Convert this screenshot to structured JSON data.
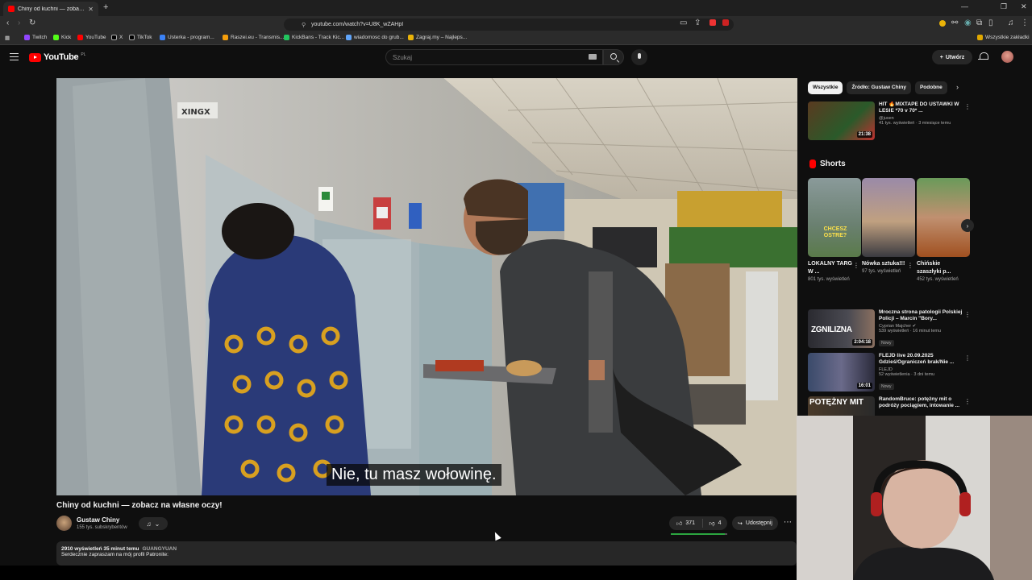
{
  "browser": {
    "tab_title": "Chiny od kuchni — zobacz na",
    "url": "youtube.com/watch?v=U8K_wZAHpI",
    "bookmarks": [
      "Twitch",
      "Kick",
      "YouTube",
      "X",
      "TikTok",
      "Usterka - program...",
      "Raszei.eu - Transmis...",
      "KickBans - Track Kic...",
      "wiadomosc do grub...",
      "Zagraj.my – Najleps..."
    ],
    "bookmark_colors": [
      "#9146ff",
      "#53fc18",
      "#ff0000",
      "#ffffff",
      "#ffffff",
      "#3b82f6",
      "#f59e0b",
      "#22c55e",
      "#60a5fa",
      "#eab308"
    ],
    "all_bookmarks": "Wszystkie zakładki"
  },
  "yt": {
    "logo": "YouTube",
    "logo_region": "PL",
    "search_placeholder": "Szukaj",
    "create_label": "Utwórz",
    "accent": "#ff0000"
  },
  "video": {
    "subtitle": "Nie, tu masz wołowinę.",
    "title": "Chiny od kuchni — zobacz na własne oczy!",
    "channel": "Gustaw Chiny",
    "subscribers": "155 tys. subskrybentów",
    "likes": "371",
    "dislikes": "4",
    "like_ratio": 0.96,
    "share_label": "Udostępnij",
    "stats": "2910 wyświetleń  35 minut temu",
    "location": "GUANGYUAN",
    "description": "Serdecznie zapraszam na mój profil Patronite:"
  },
  "sidebar": {
    "chips": [
      "Wszystkie",
      "Źródło: Gustaw Chiny",
      "Podobne"
    ],
    "top_rec": {
      "title": "HIT 🔥MIXTAPE DO USTAWKI W LESIE *70 v 70* ...",
      "channel": "@jusen",
      "meta": "41 tys. wyświetleń · 3 miesiące temu",
      "duration": "21:38"
    },
    "shorts_label": "Shorts",
    "shorts": [
      {
        "title": "LOKALNY TARG W ...",
        "views": "801 tys. wyświetleń",
        "overlay": "CHCESZ OSTRE?"
      },
      {
        "title": "Nówka sztuka!!!",
        "views": "97 tys. wyświetleń",
        "overlay": ""
      },
      {
        "title": "Chińskie szaszłyki p...",
        "views": "452 tys. wyświetleń",
        "overlay": ""
      }
    ],
    "recs": [
      {
        "title": "Mroczna strona patologii Polskiej Policji – Marcin \"Bory...",
        "channel": "Cyprian Majcher ✔",
        "meta": "539 wyświetleń · 16 minut temu",
        "badge": "Nowy",
        "duration": "2:04:18",
        "overlay": "ZGNILIZNA"
      },
      {
        "title": "FLEJD live 20.09.2025 Gdzieś/Ograniczeń brak/Nie ...",
        "channel": "FLEJD",
        "meta": "52 wyświetlenia · 3 dni temu",
        "badge": "Nowy",
        "duration": "16:01",
        "overlay": ""
      },
      {
        "title": "RandomBruce: potężny mit o podróży pociągiem, intowanie ...",
        "channel": "",
        "meta": "",
        "badge": "",
        "duration": "",
        "overlay": "POTĘŻNY MIT"
      }
    ]
  }
}
